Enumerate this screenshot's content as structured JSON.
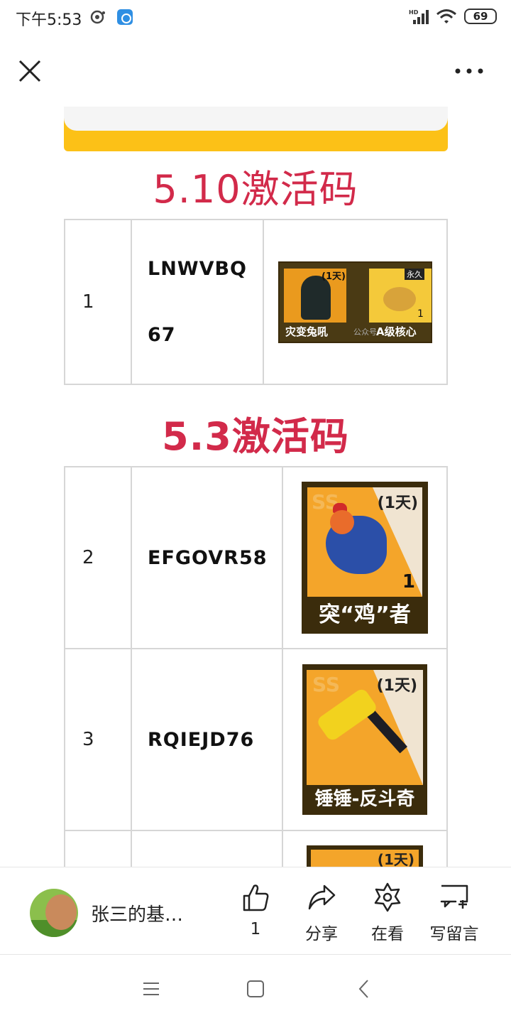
{
  "status_bar": {
    "time": "下午5:53",
    "battery": "69",
    "icons": [
      "record-icon",
      "app-notification-icon",
      "hd-signal-icon",
      "wifi-icon",
      "battery-icon"
    ]
  },
  "nav": {
    "close_icon": "close-icon",
    "more_icon": "more-dots-icon"
  },
  "article": {
    "banner_color": "#fcc117",
    "title_color": "#d22a4a",
    "section1": {
      "title": "5.10激活码",
      "rows": [
        {
          "num": "1",
          "code_line1": "LNWVBQ",
          "code_line2": "67",
          "image": {
            "day_tag": "(1天)",
            "perm_tag": "永久",
            "count": "1",
            "item1_label": "灾变兔吼",
            "watermark": "公众号",
            "item2_label": "A级核心"
          }
        }
      ]
    },
    "section2": {
      "title": "5.3激活码",
      "rows": [
        {
          "num": "2",
          "code": "EFGOVR58",
          "image": {
            "ss": "SS",
            "day_tag": "(1天)",
            "count": "1",
            "label": "突“鸡”者"
          }
        },
        {
          "num": "3",
          "code": "RQIEJD76",
          "image": {
            "ss": "SS",
            "day_tag": "(1天)",
            "label": "锤锤-反斗奇"
          }
        },
        {
          "num": "",
          "code": "",
          "image": {
            "day_tag": "(1天)"
          }
        }
      ]
    }
  },
  "action_bar": {
    "account_name": "张三的基…",
    "like_count": "1",
    "share_label": "分享",
    "look_label": "在看",
    "comment_label": "写留言"
  },
  "system_nav": {
    "icons": [
      "menu-icon",
      "home-icon",
      "back-icon"
    ]
  }
}
